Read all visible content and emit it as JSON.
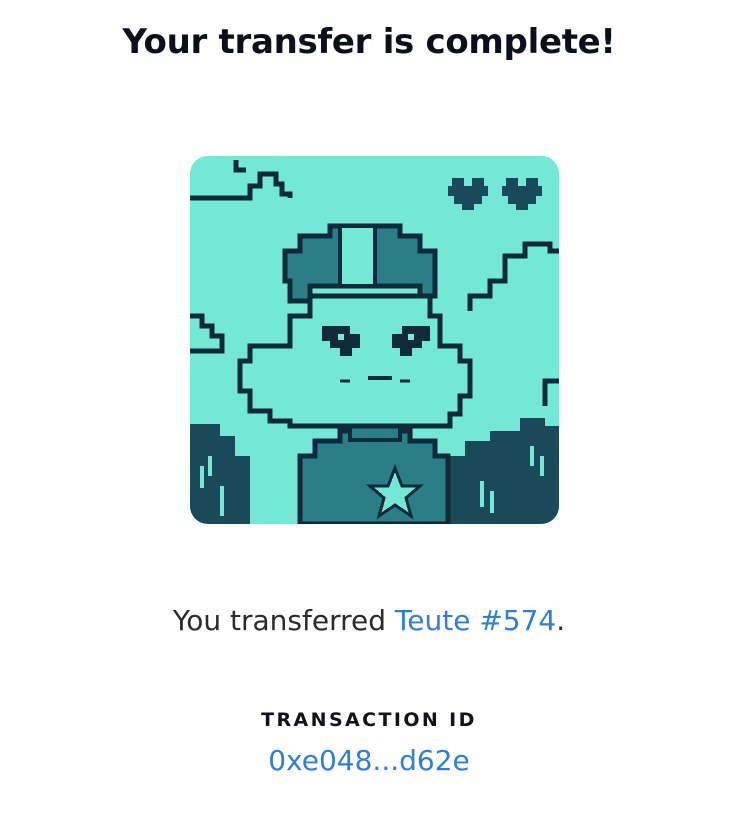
{
  "header": {
    "title": "Your transfer is complete!"
  },
  "nft": {
    "image_description": "pixel-art-alien-with-cap",
    "colors": {
      "background": "#73e8d6",
      "dark": "#0e2a3b",
      "teal": "#2a7f86",
      "deep": "#1a4a5a"
    }
  },
  "summary": {
    "prefix": "You transferred ",
    "item_link": "Teute #574",
    "suffix": "."
  },
  "transaction": {
    "label": "TRANSACTION ID",
    "id": "0xe048...d62e"
  },
  "accent_color": "#2f7fd6"
}
